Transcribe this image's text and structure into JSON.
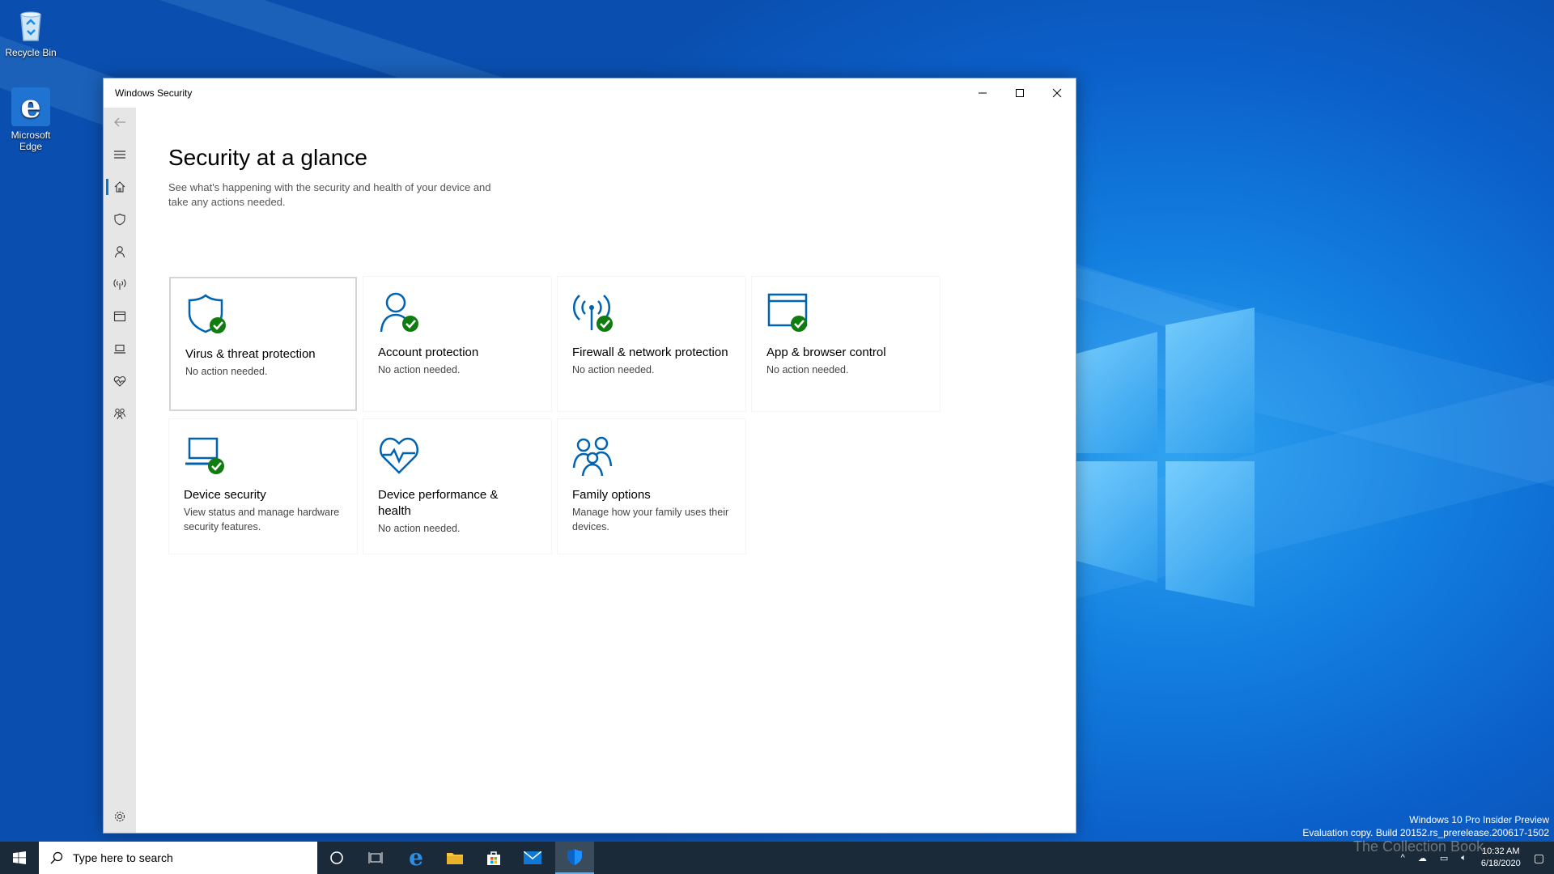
{
  "desktop": {
    "icons": [
      {
        "label": "Recycle Bin"
      },
      {
        "label": "Microsoft Edge"
      }
    ],
    "watermark": {
      "line1": "Windows 10 Pro Insider Preview",
      "line2": "Evaluation copy. Build 20152.rs_prerelease.200617-1502"
    },
    "overlay_text": "The Collection Book"
  },
  "window": {
    "title": "Windows Security",
    "controls": {
      "minimize": "–",
      "maximize": "☐",
      "close": "✕"
    }
  },
  "nav": {
    "items": [
      {
        "id": "back",
        "icon": "back-arrow-icon"
      },
      {
        "id": "menu",
        "icon": "hamburger-menu-icon"
      },
      {
        "id": "home",
        "icon": "home-icon",
        "active": true
      },
      {
        "id": "virus",
        "icon": "shield-icon"
      },
      {
        "id": "account",
        "icon": "person-icon"
      },
      {
        "id": "firewall",
        "icon": "antenna-icon"
      },
      {
        "id": "browser",
        "icon": "browser-window-icon"
      },
      {
        "id": "device",
        "icon": "laptop-icon"
      },
      {
        "id": "health",
        "icon": "heart-pulse-icon"
      },
      {
        "id": "family",
        "icon": "family-icon"
      },
      {
        "id": "settings",
        "icon": "gear-icon"
      }
    ]
  },
  "main": {
    "title": "Security at a glance",
    "subtitle": "See what's happening with the security and health of your device and take any actions needed.",
    "tiles": [
      {
        "name": "Virus & threat protection",
        "status": "No action needed.",
        "icon": "shield-check-icon"
      },
      {
        "name": "Account protection",
        "status": "No action needed.",
        "icon": "person-check-icon"
      },
      {
        "name": "Firewall & network protection",
        "status": "No action needed.",
        "icon": "antenna-check-icon"
      },
      {
        "name": "App & browser control",
        "status": "No action needed.",
        "icon": "browser-check-icon"
      },
      {
        "name": "Device security",
        "status": "View status and manage hardware security features.",
        "icon": "laptop-check-icon"
      },
      {
        "name": "Device performance & health",
        "status": "No action needed.",
        "icon": "heart-pulse-icon"
      },
      {
        "name": "Family options",
        "status": "Manage how your family uses their devices.",
        "icon": "family-icon"
      }
    ]
  },
  "taskbar": {
    "search_placeholder": "Type here to search",
    "time": "10:32 AM",
    "date": "6/18/2020"
  },
  "colors": {
    "accent": "#0078d7",
    "icon_blue": "#0063b1",
    "check_green": "#107c10",
    "taskbar": "#1b2a38"
  }
}
